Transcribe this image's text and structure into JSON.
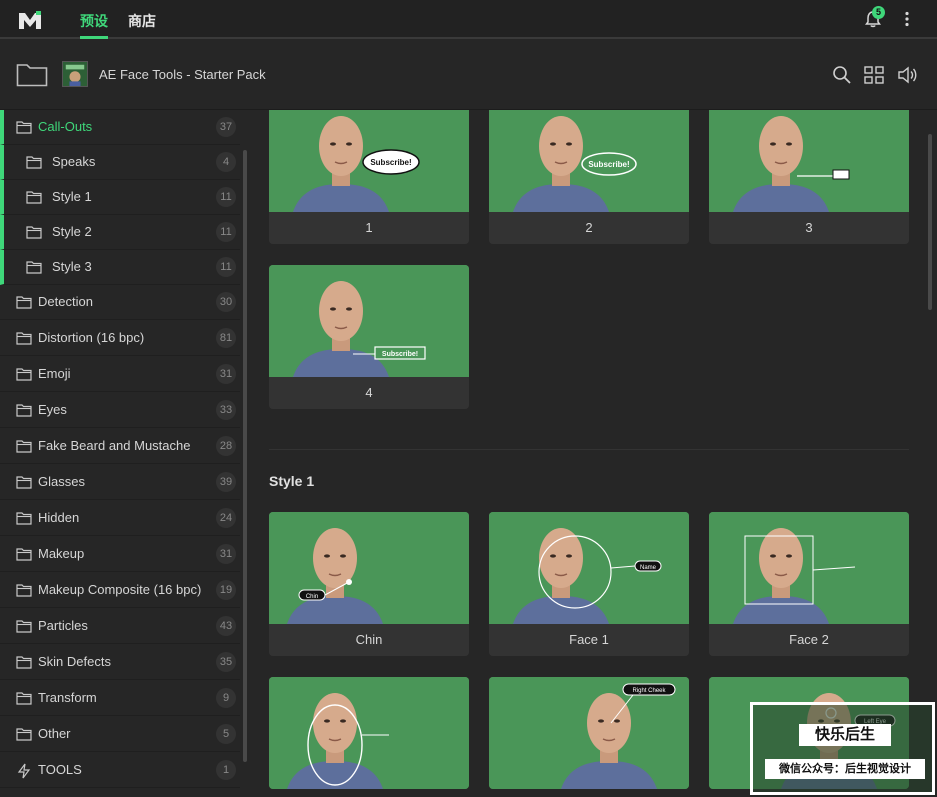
{
  "topbar": {
    "tabs": [
      {
        "label": "预设",
        "active": true
      },
      {
        "label": "商店",
        "active": false
      }
    ],
    "notification_count": "5",
    "accent_color": "#3fd77a"
  },
  "header": {
    "pack_title": "AE Face Tools - Starter Pack"
  },
  "sidebar": {
    "items": [
      {
        "label": "Call-Outs",
        "count": "37",
        "icon": "folder-icon",
        "active": true,
        "indent": false
      },
      {
        "label": "Speaks",
        "count": "4",
        "icon": "folder-icon",
        "indent": true
      },
      {
        "label": "Style 1",
        "count": "11",
        "icon": "folder-icon",
        "indent": true
      },
      {
        "label": "Style 2",
        "count": "11",
        "icon": "folder-icon",
        "indent": true
      },
      {
        "label": "Style 3",
        "count": "11",
        "icon": "folder-icon",
        "indent": true
      },
      {
        "label": "Detection",
        "count": "30",
        "icon": "folder-icon",
        "indent": false
      },
      {
        "label": "Distortion (16 bpc)",
        "count": "81",
        "icon": "folder-icon",
        "indent": false
      },
      {
        "label": "Emoji",
        "count": "31",
        "icon": "folder-icon",
        "indent": false
      },
      {
        "label": "Eyes",
        "count": "33",
        "icon": "folder-icon",
        "indent": false
      },
      {
        "label": "Fake Beard and Mustache",
        "count": "28",
        "icon": "folder-icon",
        "indent": false
      },
      {
        "label": "Glasses",
        "count": "39",
        "icon": "folder-icon",
        "indent": false
      },
      {
        "label": "Hidden",
        "count": "24",
        "icon": "folder-icon",
        "indent": false
      },
      {
        "label": "Makeup",
        "count": "31",
        "icon": "folder-icon",
        "indent": false
      },
      {
        "label": "Makeup Composite (16 bpc)",
        "count": "19",
        "icon": "folder-icon",
        "indent": false
      },
      {
        "label": "Particles",
        "count": "43",
        "icon": "folder-icon",
        "indent": false
      },
      {
        "label": "Skin Defects",
        "count": "35",
        "icon": "folder-icon",
        "indent": false
      },
      {
        "label": "Transform",
        "count": "9",
        "icon": "folder-icon",
        "indent": false
      },
      {
        "label": "Other",
        "count": "5",
        "icon": "folder-icon",
        "indent": false
      },
      {
        "label": "TOOLS",
        "count": "1",
        "icon": "lightning-icon",
        "indent": false
      }
    ]
  },
  "main": {
    "speaks_cards": [
      {
        "label": "1",
        "bubble": "Subscribe!"
      },
      {
        "label": "2",
        "bubble": "Subscribe!"
      },
      {
        "label": "3",
        "bubble": ""
      },
      {
        "label": "4",
        "bubble": "Subscribe!"
      }
    ],
    "style1_title": "Style 1",
    "style1_cards": [
      {
        "label": "Chin",
        "tag": "Chin"
      },
      {
        "label": "Face 1",
        "tag": "Name"
      },
      {
        "label": "Face 2",
        "tag": ""
      },
      {
        "label": "",
        "tag": ""
      },
      {
        "label": "",
        "tag": "Right Cheek"
      },
      {
        "label": "",
        "tag": "Left Eye"
      }
    ]
  },
  "watermark": {
    "title": "快乐后生",
    "subtitle": "微信公众号：后生视觉设计"
  }
}
